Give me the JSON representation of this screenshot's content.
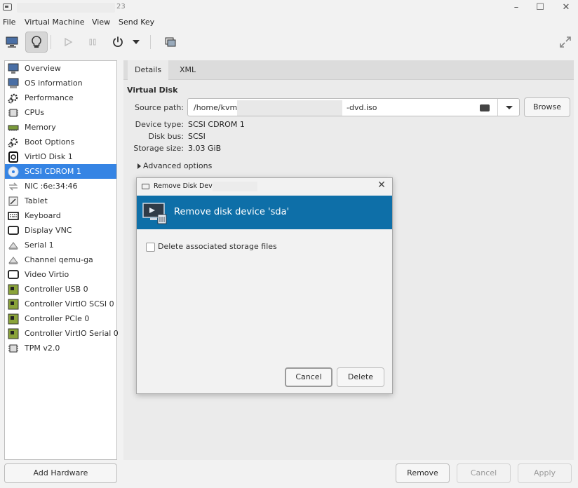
{
  "window": {
    "title_suffix": "23",
    "controls": {
      "minimize": "–",
      "maximize": "☐",
      "close": "✕"
    }
  },
  "menu": [
    "File",
    "Virtual Machine",
    "View",
    "Send Key"
  ],
  "toolbar": {
    "icons": [
      "monitor-icon",
      "lightbulb-icon",
      "play-icon",
      "pause-icon",
      "power-icon",
      "chevron-down-icon",
      "snapshot-icon",
      "fullscreen-icon"
    ]
  },
  "sidebar": {
    "items": [
      {
        "label": "Overview",
        "icon": "overview-icon"
      },
      {
        "label": "OS information",
        "icon": "os-info-icon"
      },
      {
        "label": "Performance",
        "icon": "performance-icon"
      },
      {
        "label": "CPUs",
        "icon": "cpu-icon"
      },
      {
        "label": "Memory",
        "icon": "memory-icon"
      },
      {
        "label": "Boot Options",
        "icon": "boot-options-icon"
      },
      {
        "label": "VirtIO Disk 1",
        "icon": "disk-icon"
      },
      {
        "label": "SCSI CDROM 1",
        "icon": "cdrom-icon",
        "selected": true
      },
      {
        "label": "NIC :6e:34:46",
        "icon": "nic-icon"
      },
      {
        "label": "Tablet",
        "icon": "tablet-icon"
      },
      {
        "label": "Keyboard",
        "icon": "keyboard-icon"
      },
      {
        "label": "Display VNC",
        "icon": "display-icon"
      },
      {
        "label": "Serial 1",
        "icon": "serial-icon"
      },
      {
        "label": "Channel qemu-ga",
        "icon": "channel-icon"
      },
      {
        "label": "Video Virtio",
        "icon": "video-icon"
      },
      {
        "label": "Controller USB 0",
        "icon": "controller-icon"
      },
      {
        "label": "Controller VirtIO SCSI 0",
        "icon": "controller-icon"
      },
      {
        "label": "Controller PCIe 0",
        "icon": "controller-icon"
      },
      {
        "label": "Controller VirtIO Serial 0",
        "icon": "controller-icon"
      },
      {
        "label": "TPM v2.0",
        "icon": "tpm-icon"
      }
    ],
    "add_hardware": "Add Hardware"
  },
  "details": {
    "tabs": [
      "Details",
      "XML"
    ],
    "section_title": "Virtual Disk",
    "source_path_label": "Source path:",
    "source_path_prefix": "/home/kvm/",
    "source_path_suffix": "-dvd.iso",
    "browse": "Browse",
    "device_type_label": "Device type:",
    "device_type": "SCSI CDROM 1",
    "disk_bus_label": "Disk bus:",
    "disk_bus": "SCSI",
    "storage_size_label": "Storage size:",
    "storage_size": "3.03 GiB",
    "advanced_options": "Advanced options"
  },
  "bottom_buttons": {
    "remove": "Remove",
    "cancel": "Cancel",
    "apply": "Apply"
  },
  "dialog": {
    "title": "Remove Disk Device",
    "header": "Remove disk device 'sda'",
    "checkbox_label": "Delete associated storage files",
    "checkbox_checked": false,
    "cancel": "Cancel",
    "delete": "Delete",
    "header_color": "#0e6fa8"
  },
  "colors": {
    "selection": "#3584e4",
    "accent": "#0e6fa8"
  }
}
